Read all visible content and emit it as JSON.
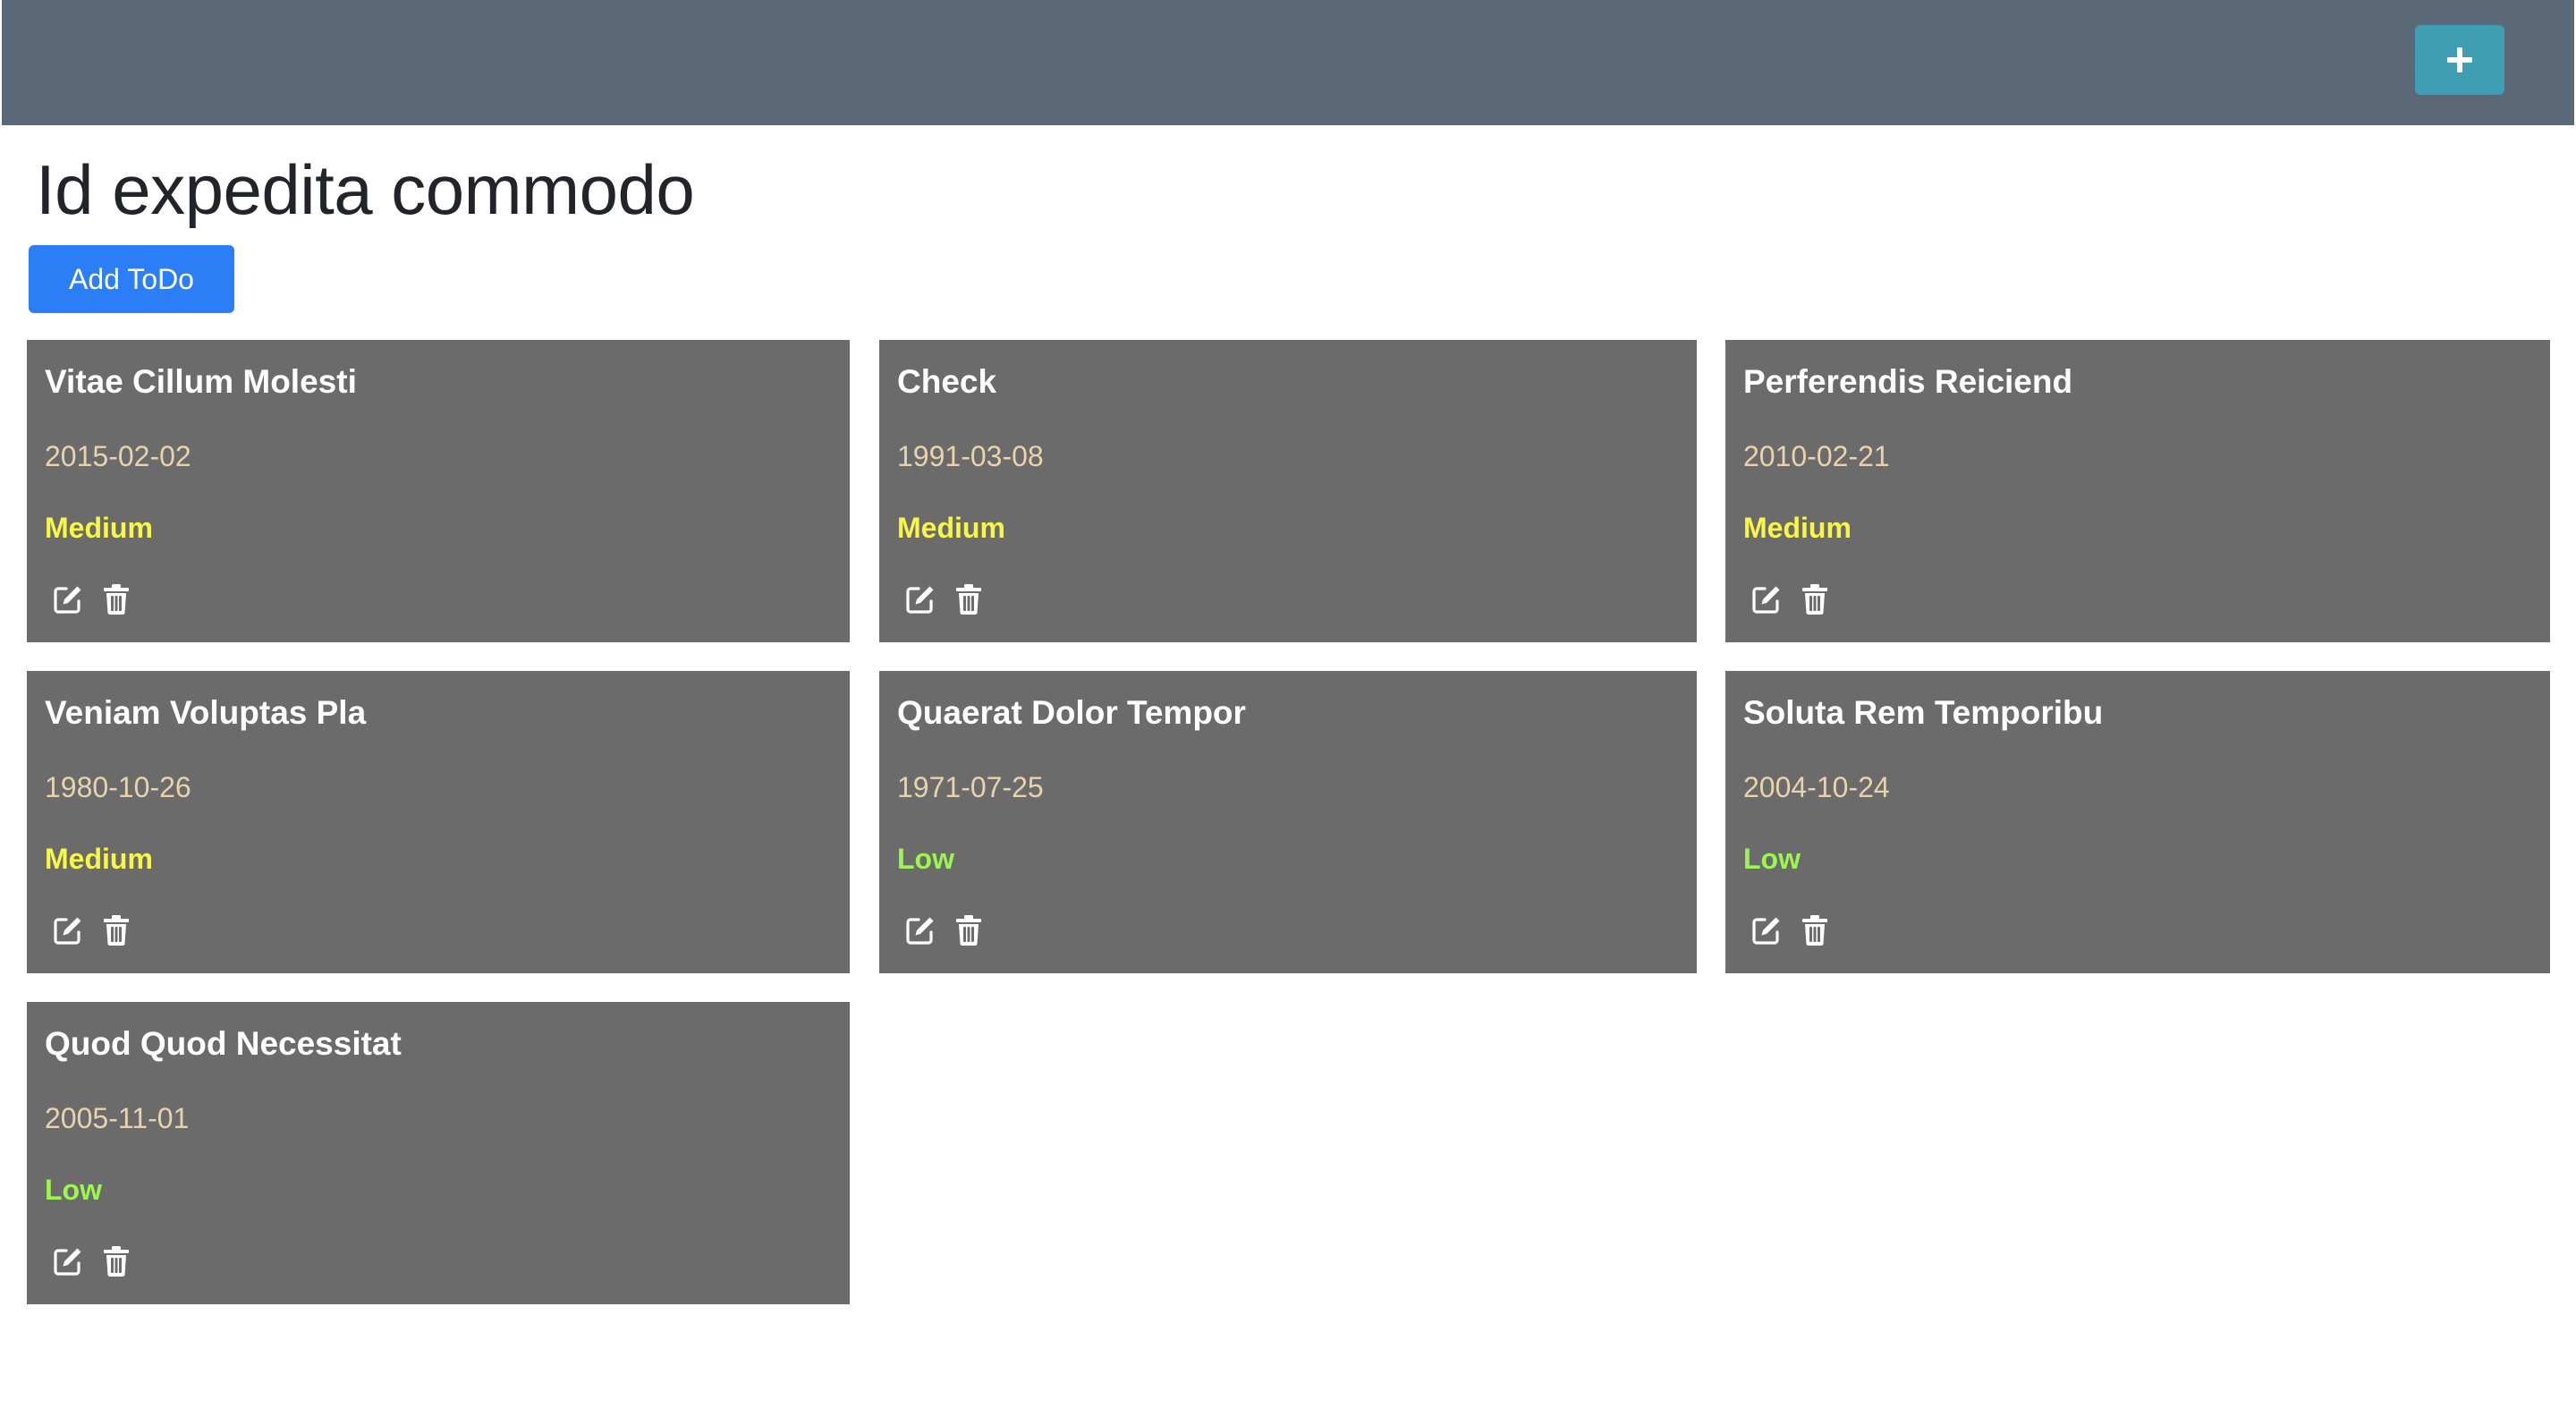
{
  "header": {
    "add_button_symbol": "+"
  },
  "page": {
    "title": "Id expedita commodo",
    "add_todo_label": "Add ToDo"
  },
  "colors": {
    "header_bg": "#5a6878",
    "plus_button": "#3f9eb4",
    "add_button": "#2c7ef6",
    "card_bg": "#6b6b6b",
    "date_text": "#e8d3ad",
    "priority_medium": "#f7f74a",
    "priority_low": "#9cf550"
  },
  "todos": [
    {
      "title": "Vitae Cillum Molesti",
      "date": "2015-02-02",
      "priority": "Medium"
    },
    {
      "title": "Check",
      "date": "1991-03-08",
      "priority": "Medium"
    },
    {
      "title": "Perferendis Reiciend",
      "date": "2010-02-21",
      "priority": "Medium"
    },
    {
      "title": "Veniam Voluptas Pla",
      "date": "1980-10-26",
      "priority": "Medium"
    },
    {
      "title": "Quaerat Dolor Tempor",
      "date": "1971-07-25",
      "priority": "Low"
    },
    {
      "title": "Soluta Rem Temporibu",
      "date": "2004-10-24",
      "priority": "Low"
    },
    {
      "title": "Quod Quod Necessitat",
      "date": "2005-11-01",
      "priority": "Low"
    }
  ],
  "icons": {
    "edit": "edit-icon",
    "delete": "trash-icon",
    "add": "plus-icon"
  }
}
